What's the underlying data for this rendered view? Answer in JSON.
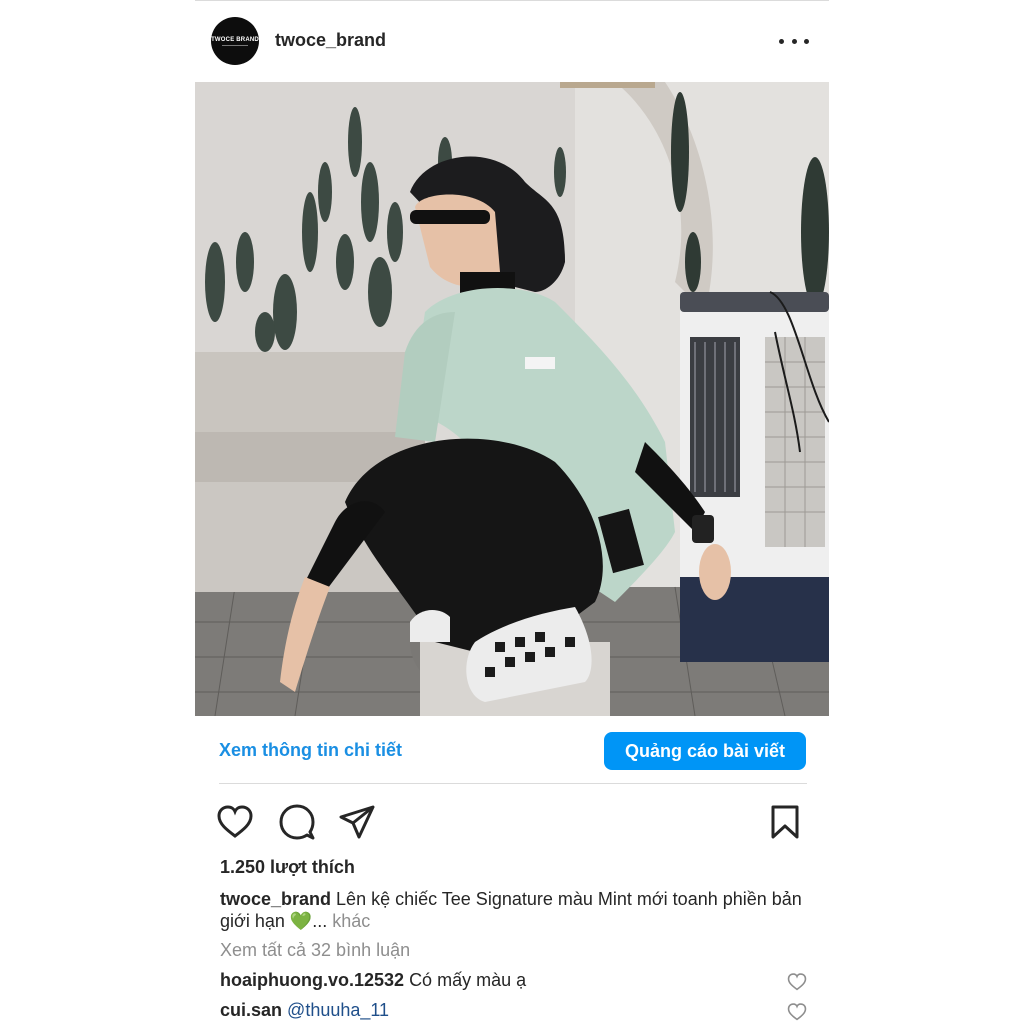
{
  "account": {
    "username": "twoce_brand",
    "avatar_text": "TWOCE BRAND"
  },
  "post": {
    "details_link": "Xem thông tin chi tiết",
    "promote_button": "Quảng cáo bài viết",
    "likes": "1.250 lượt thích",
    "caption_user": "twoce_brand",
    "caption_text": "Lên kệ chiếc Tee Signature màu Mint mới toanh phiền bản giới hạn 💚...",
    "caption_more": "khác",
    "view_comments": "Xem tất cả 32 bình luận",
    "comments": [
      {
        "user": "hoaiphuong.vo.12532",
        "text": "Có mấy màu ạ"
      },
      {
        "user": "cui.san",
        "text": "@thuuha_11"
      }
    ]
  },
  "icons": [
    "more-icon",
    "heart-icon",
    "comment-icon",
    "share-icon",
    "bookmark-icon"
  ],
  "colors": {
    "accent": "#0095f6",
    "link": "#1a8fe3",
    "muted": "#8e8e8e",
    "text": "#262626",
    "mint_shirt": "#bcd6c9"
  }
}
